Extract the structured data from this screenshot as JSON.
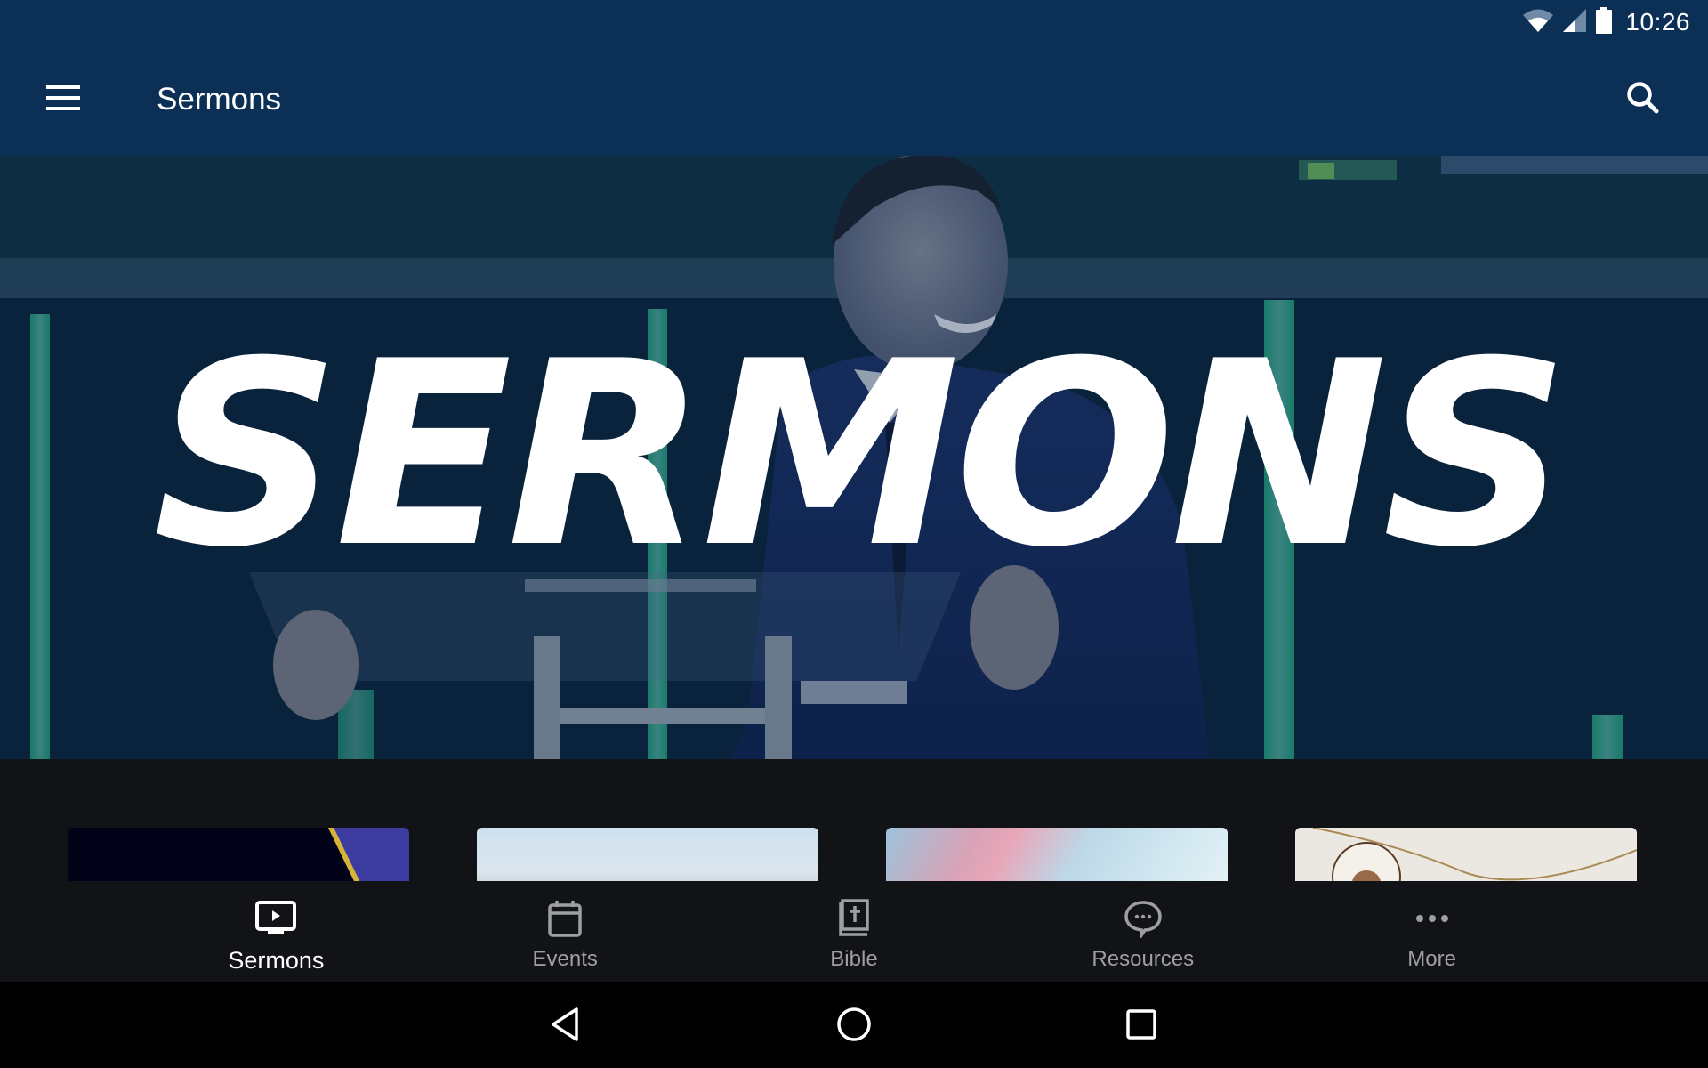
{
  "status_bar": {
    "time": "10:26",
    "icons": [
      "wifi-icon",
      "cellular-signal-icon",
      "battery-icon"
    ]
  },
  "app_bar": {
    "title": "Sermons",
    "menu_icon": "hamburger-menu-icon",
    "search_icon": "search-icon"
  },
  "hero": {
    "title": "SERMONS",
    "image_description": "Pastor smiling at a clear acrylic podium on stage with green light pillars"
  },
  "series_cards": [
    {
      "id": "card-1",
      "style": "dark navy with purple and gold diagonal stripe"
    },
    {
      "id": "card-2",
      "style": "pale sky blue"
    },
    {
      "id": "card-3",
      "style": "pastel pink and blue clouds"
    },
    {
      "id": "card-4",
      "style": "white textured plaster with gold line"
    }
  ],
  "bottom_nav": {
    "items": [
      {
        "label": "Sermons",
        "icon": "tv-play-icon",
        "active": true
      },
      {
        "label": "Events",
        "icon": "calendar-icon",
        "active": false
      },
      {
        "label": "Bible",
        "icon": "bible-icon",
        "active": false
      },
      {
        "label": "Resources",
        "icon": "chat-bubble-icon",
        "active": false
      },
      {
        "label": "More",
        "icon": "more-dots-icon",
        "active": false
      }
    ]
  },
  "system_nav": {
    "back": "back-icon",
    "home": "home-icon",
    "recents": "recents-icon"
  },
  "colors": {
    "app_bar": "#0c2f55",
    "background": "#121316",
    "nav_active": "#ffffff",
    "nav_inactive": "#9e9fa3",
    "hero_accent_green": "#2fb88a"
  }
}
